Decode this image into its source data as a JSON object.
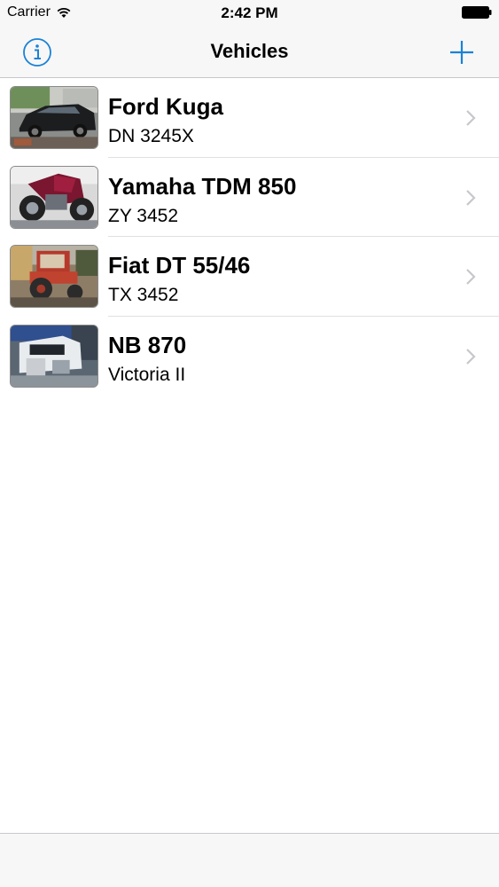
{
  "status_bar": {
    "carrier": "Carrier",
    "time": "2:42 PM",
    "wifi_icon": "wifi-icon",
    "battery_icon": "battery-icon"
  },
  "nav": {
    "title": "Vehicles",
    "info_icon": "info-icon",
    "add_icon": "plus-icon",
    "tint_color": "#1a82d6"
  },
  "vehicles": [
    {
      "name": "Ford Kuga",
      "subtitle": "DN 3245X",
      "thumbnail": "car-photo"
    },
    {
      "name": "Yamaha TDM 850",
      "subtitle": "ZY 3452",
      "thumbnail": "motorcycle-photo"
    },
    {
      "name": "Fiat DT 55/46",
      "subtitle": "TX 3452",
      "thumbnail": "tractor-photo"
    },
    {
      "name": "NB 870",
      "subtitle": "Victoria II",
      "thumbnail": "boat-photo"
    }
  ]
}
